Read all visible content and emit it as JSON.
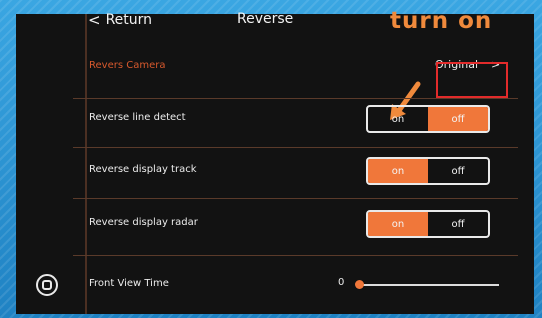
{
  "header": {
    "back_label": "Return",
    "back_chevron": "<",
    "title": "Reverse"
  },
  "annotation": {
    "text": "turn on",
    "color": "#f08a3c"
  },
  "camera_row": {
    "label": "Revers Camera",
    "value": "Original",
    "chevron": ">"
  },
  "settings": [
    {
      "label": "Reverse line detect",
      "on_label": "on",
      "off_label": "off",
      "selected": "off"
    },
    {
      "label": "Reverse display track",
      "on_label": "on",
      "off_label": "off",
      "selected": "on"
    },
    {
      "label": "Reverse display radar",
      "on_label": "on",
      "off_label": "off",
      "selected": "on"
    }
  ],
  "front_view": {
    "label": "Front View Time",
    "value": "0",
    "slider_level": 0
  },
  "colors": {
    "accent": "#f0773a",
    "highlight_box": "#e22b2b",
    "background": "#121212"
  },
  "icons": {
    "home": "home-icon",
    "back": "chevron-left-icon",
    "camera_next": "chevron-right-icon"
  }
}
